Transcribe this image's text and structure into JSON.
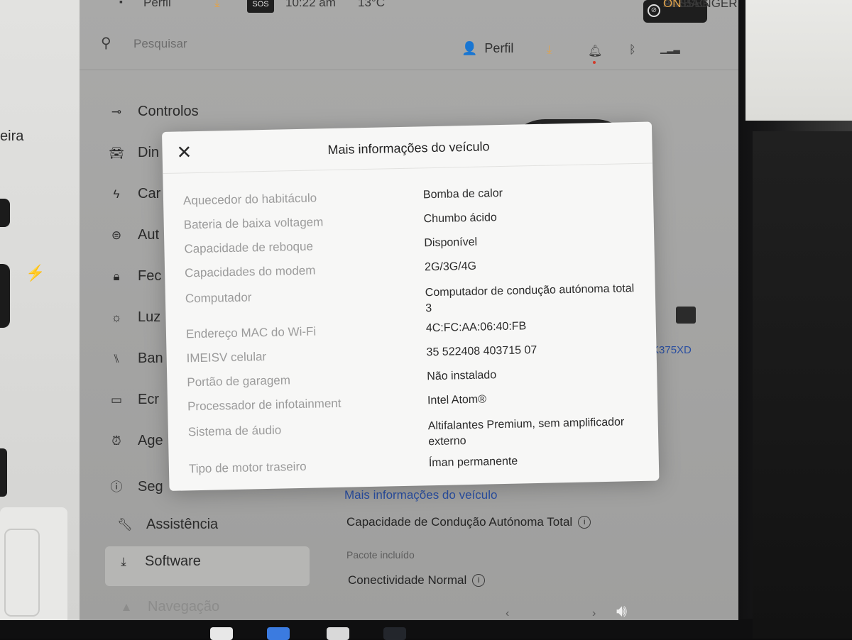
{
  "status_bar": {
    "profile_label": "Perfil",
    "sos_label": "SOS",
    "time": "10:22 am",
    "temperature": "13°C",
    "airbag": {
      "line1": "PASSENGER",
      "line2": "AIRBAG",
      "state": "ON"
    }
  },
  "top_bar": {
    "search_placeholder": "Pesquisar",
    "profile_label": "Perfil",
    "icons": [
      "download-icon",
      "bell-icon",
      "bluetooth-icon",
      "signal-icon"
    ],
    "accent_download": "#e0a34d",
    "notification_dot": "#d13a2a"
  },
  "left_panel": {
    "label": "eira"
  },
  "sidebar": {
    "items": [
      {
        "label": "Controlos",
        "icon": "toggle-icon"
      },
      {
        "label": "Din",
        "icon": "car-icon"
      },
      {
        "label": "Car",
        "icon": "bolt-icon"
      },
      {
        "label": "Aut",
        "icon": "steering-wheel-icon"
      },
      {
        "label": "Fec",
        "icon": "lock-icon"
      },
      {
        "label": "Luz",
        "icon": "light-icon"
      },
      {
        "label": "Ban",
        "icon": "seat-icon"
      },
      {
        "label": "Ecr",
        "icon": "display-icon"
      },
      {
        "label": "Age",
        "icon": "alarm-icon"
      },
      {
        "label": "Seg",
        "icon": "alert-icon"
      },
      {
        "label": "Assistência",
        "icon": "wrench-icon"
      },
      {
        "label": "Software",
        "icon": "download-icon",
        "active": true
      },
      {
        "label": "Navegação",
        "icon": "navigation-icon"
      }
    ]
  },
  "main": {
    "vin_partial": "K375XD",
    "more_info_link": "Mais informações do veículo",
    "fsd_title": "Capacidade de Condução Autónoma Total",
    "fsd_subtitle": "Pacote incluído",
    "connectivity_title": "Conectividade Normal"
  },
  "modal": {
    "title": "Mais informações do veículo",
    "rows": [
      {
        "key": "Aquecedor do habitáculo",
        "value": "Bomba de calor"
      },
      {
        "key": "Bateria de baixa voltagem",
        "value": "Chumbo ácido"
      },
      {
        "key": "Capacidade de reboque",
        "value": "Disponível"
      },
      {
        "key": "Capacidades do modem",
        "value": "2G/3G/4G"
      },
      {
        "key": "Computador",
        "value": "Computador de condução autónoma total 3"
      },
      {
        "key": "Endereço MAC do Wi-Fi",
        "value": "4C:FC:AA:06:40:FB"
      },
      {
        "key": "IMEISV celular",
        "value": "35 522408 403715 07"
      },
      {
        "key": "Portão de garagem",
        "value": "Não instalado"
      },
      {
        "key": "Processador de infotainment",
        "value": "Intel Atom®"
      },
      {
        "key": "Sistema de áudio",
        "value": "Altifalantes Premium, sem amplificador externo"
      },
      {
        "key": "Tipo de motor traseiro",
        "value": "Íman permanente"
      }
    ]
  }
}
